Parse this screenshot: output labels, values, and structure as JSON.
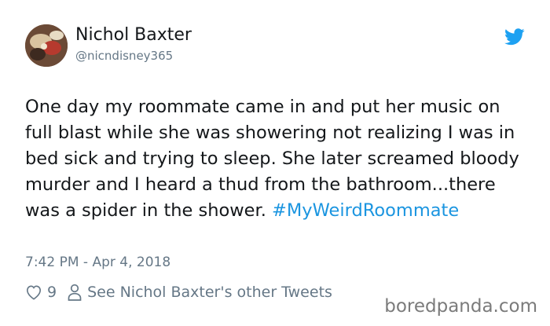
{
  "user": {
    "display_name": "Nichol Baxter",
    "handle": "@nicndisney365"
  },
  "tweet": {
    "text": "One day my roommate came in and put her music on full blast while she was showering not realizing I was in bed sick and trying to sleep. She later screamed bloody murder and I heard a thud from the bathroom...there was a spider in the shower.",
    "hashtag": "#MyWeirdRoommate",
    "timestamp": "7:42 PM - Apr 4, 2018"
  },
  "actions": {
    "like_count": "9",
    "other_tweets_label": "See Nichol Baxter's other Tweets"
  },
  "icons": {
    "brand": "twitter-bird-icon",
    "like": "heart-icon",
    "profile": "person-icon"
  },
  "colors": {
    "link": "#1b95e0",
    "secondary_text": "#657786",
    "primary_text": "#14171a",
    "twitter_blue": "#1da1f2"
  },
  "watermark": {
    "text": "boredpanda.com"
  }
}
